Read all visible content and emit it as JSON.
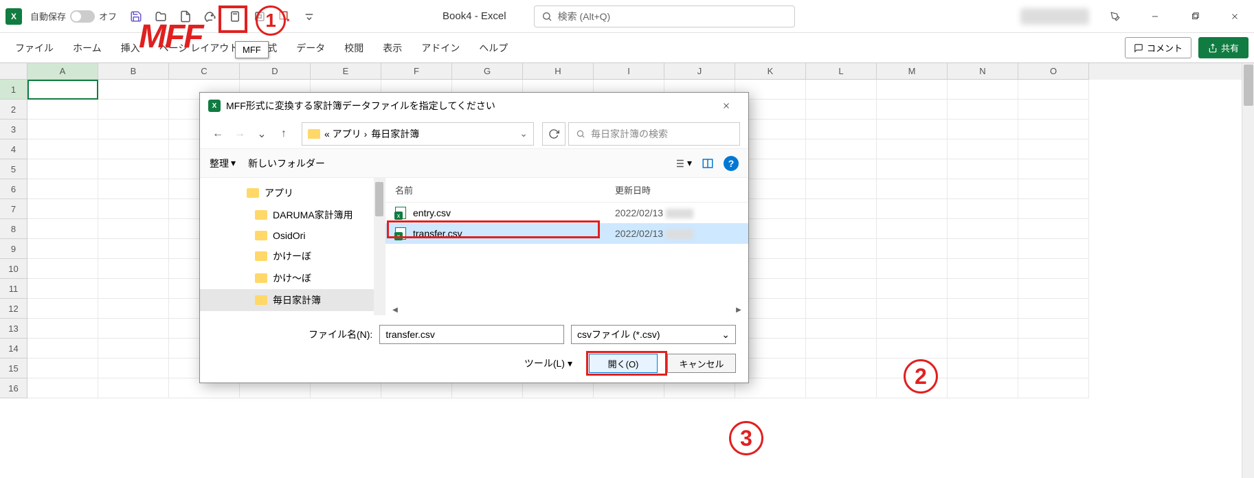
{
  "titlebar": {
    "autosave_label": "自動保存",
    "autosave_state": "オフ",
    "doc_title": "Book4  -  Excel",
    "search_placeholder": "検索 (Alt+Q)"
  },
  "annotations": {
    "mff_text": "MFF",
    "tooltip": "MFF",
    "n1": "1",
    "n2": "2",
    "n3": "3"
  },
  "ribbon": {
    "tabs": [
      "ファイル",
      "ホーム",
      "挿入",
      "ページ レイアウト",
      "数式",
      "データ",
      "校閲",
      "表示",
      "アドイン",
      "ヘルプ"
    ],
    "comment": "コメント",
    "share": "共有"
  },
  "grid": {
    "cols": [
      "A",
      "B",
      "C",
      "D",
      "E",
      "F",
      "G",
      "H",
      "I",
      "J",
      "K",
      "L",
      "M",
      "N",
      "O"
    ],
    "rows": [
      "1",
      "2",
      "3",
      "4",
      "5",
      "6",
      "7",
      "8",
      "9",
      "10",
      "11",
      "12",
      "13",
      "14",
      "15",
      "16"
    ]
  },
  "dialog": {
    "title": "MFF形式に変換する家計簿データファイルを指定してください",
    "breadcrumb_prefix": "«  アプリ  ›",
    "breadcrumb_current": "毎日家計簿",
    "search_placeholder": "毎日家計簿の検索",
    "toolbar": {
      "organize": "整理",
      "newfolder": "新しいフォルダー"
    },
    "tree": [
      {
        "label": "アプリ",
        "level": 0
      },
      {
        "label": "DARUMA家計簿用",
        "level": 1
      },
      {
        "label": "OsidOri",
        "level": 1
      },
      {
        "label": "かけーぼ",
        "level": 1
      },
      {
        "label": "かけ～ぼ",
        "level": 1
      },
      {
        "label": "毎日家計簿",
        "level": 1,
        "selected": true
      }
    ],
    "columns": {
      "name": "名前",
      "date": "更新日時"
    },
    "files": [
      {
        "name": "entry.csv",
        "date": "2022/02/13",
        "selected": false
      },
      {
        "name": "transfer.csv",
        "date": "2022/02/13",
        "selected": true
      }
    ],
    "filename_label": "ファイル名(N):",
    "filename_value": "transfer.csv",
    "filetype": "csvファイル (*.csv)",
    "tools": "ツール(L)",
    "open": "開く(O)",
    "cancel": "キャンセル"
  }
}
